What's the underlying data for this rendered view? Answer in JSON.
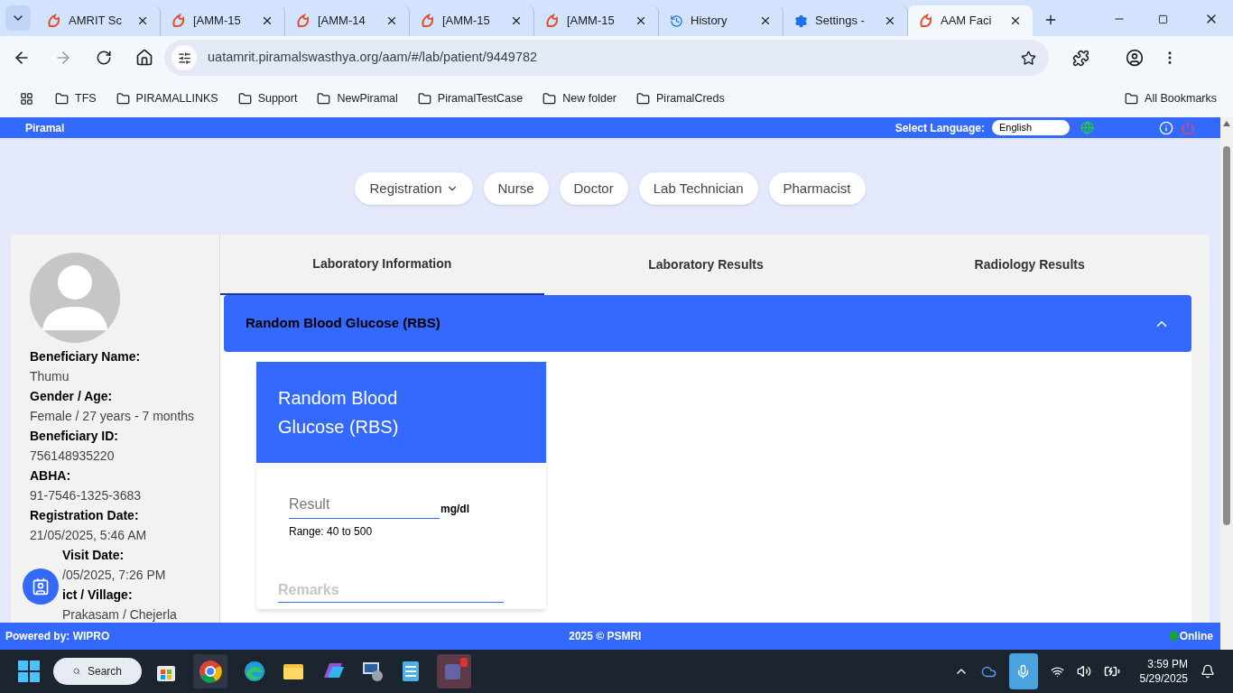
{
  "browser": {
    "tabs": [
      {
        "title": "AMRIT Sc",
        "kind": "site",
        "selected": false
      },
      {
        "title": "[AMM-15",
        "kind": "site",
        "selected": false
      },
      {
        "title": "[AMM-14",
        "kind": "site",
        "selected": false
      },
      {
        "title": "[AMM-15",
        "kind": "site",
        "selected": false
      },
      {
        "title": "[AMM-15",
        "kind": "site",
        "selected": false
      },
      {
        "title": "History",
        "kind": "history",
        "selected": false
      },
      {
        "title": "Settings -",
        "kind": "settings",
        "selected": false
      },
      {
        "title": "AAM Faci",
        "kind": "site",
        "selected": true
      }
    ],
    "url": "uatamrit.piramalswasthya.org/aam/#/lab/patient/9449782",
    "bookmarks": [
      "TFS",
      "PIRAMALLINKS",
      "Support",
      "NewPiramal",
      "PiramalTestCase",
      "New folder",
      "PiramalCreds"
    ],
    "all_bookmarks": "All Bookmarks"
  },
  "header": {
    "logo": "Piramal",
    "language_label": "Select Language:",
    "language": "English"
  },
  "nav": [
    {
      "label": "Registration",
      "dropdown": true
    },
    {
      "label": "Nurse",
      "dropdown": false
    },
    {
      "label": "Doctor",
      "dropdown": false
    },
    {
      "label": "Lab Technician",
      "dropdown": false
    },
    {
      "label": "Pharmacist",
      "dropdown": false
    }
  ],
  "beneficiary": [
    {
      "label": "Beneficiary Name:",
      "value": "Thumu"
    },
    {
      "label": "Gender / Age:",
      "value": "Female / 27 years - 7 months"
    },
    {
      "label": "Beneficiary ID:",
      "value": "756148935220"
    },
    {
      "label": "ABHA:",
      "value": "91-7546-1325-3683"
    },
    {
      "label": "Registration Date:",
      "value": "21/05/2025, 5:46 AM"
    },
    {
      "label": "Visit Date:",
      "value": "/05/2025, 7:26 PM"
    },
    {
      "label": "ict / Village:",
      "value": "Prakasam / Chejerla"
    }
  ],
  "tabs": [
    {
      "label": "Laboratory Information",
      "selected": true
    },
    {
      "label": "Laboratory Results",
      "selected": false
    },
    {
      "label": "Radiology Results",
      "selected": false
    }
  ],
  "panel": {
    "title": "Random Blood Glucose (RBS)",
    "expanded": true
  },
  "test": {
    "title": "Random Blood Glucose (RBS)",
    "result_placeholder": "Result",
    "unit": "mg/dl",
    "range": "Range: 40 to 500",
    "remarks_placeholder": "Remarks"
  },
  "footer": {
    "powered": "Powered by: WIPRO",
    "copyright": "2025 © PSMRI",
    "status": "Online",
    "online": true
  },
  "taskbar": {
    "search": "Search",
    "time": "3:59 PM",
    "date": "5/29/2025"
  }
}
